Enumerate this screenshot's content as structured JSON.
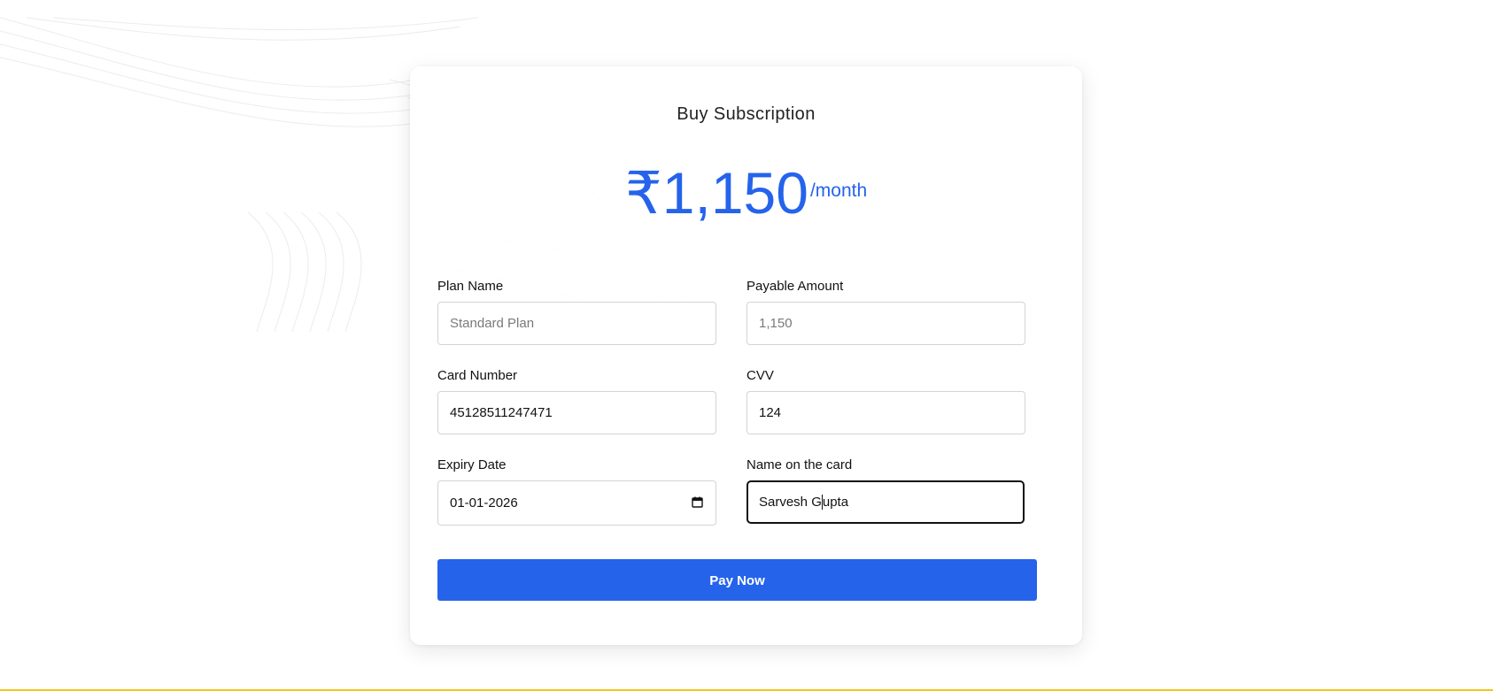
{
  "page": {
    "title": "Buy Subscription",
    "accent_color": "#2563eb",
    "bottom_border_color": "#f5c518"
  },
  "price": {
    "amount": "₹1,150",
    "period": "/month"
  },
  "form": {
    "plan_name": {
      "label": "Plan Name",
      "value": "Standard Plan",
      "readonly": true
    },
    "payable_amount": {
      "label": "Payable Amount",
      "value": "1,150",
      "readonly": true
    },
    "card_number": {
      "label": "Card Number",
      "value": "45128511247471"
    },
    "cvv": {
      "label": "CVV",
      "value": "124"
    },
    "expiry_date": {
      "label": "Expiry Date",
      "value": "01-01-2026",
      "icon": "calendar-icon"
    },
    "name_on_card": {
      "label": "Name on the card",
      "value_before_cursor": "Sarvesh G",
      "value_after_cursor": "upta",
      "focused": true
    }
  },
  "actions": {
    "pay_label": "Pay Now"
  }
}
